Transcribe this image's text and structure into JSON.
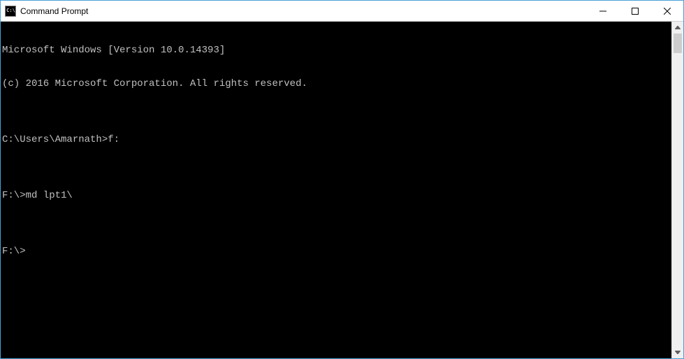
{
  "titlebar": {
    "icon_label": "C:\\",
    "title": "Command Prompt"
  },
  "terminal": {
    "lines": [
      "Microsoft Windows [Version 10.0.14393]",
      "(c) 2016 Microsoft Corporation. All rights reserved.",
      "",
      "C:\\Users\\Amarnath>f:",
      "",
      "F:\\>md lpt1\\",
      "",
      "F:\\>"
    ]
  }
}
